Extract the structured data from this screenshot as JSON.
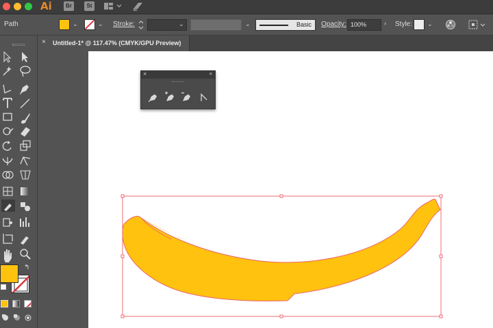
{
  "app": {
    "logo": "Ai",
    "bridge_badge": "Br",
    "stock_badge": "St"
  },
  "control_bar": {
    "selection_type": "Path",
    "fill_color": "#ffc20e",
    "stroke_label": "Stroke:",
    "brush_label": "Basic",
    "opacity_label": "Opacity:",
    "opacity_value": "100%",
    "style_label": "Style:"
  },
  "document_tab": {
    "close_glyph": "×",
    "title": "Untitled-1* @ 117.47% (CMYK/GPU Preview)"
  },
  "pen_panel": {
    "close_glyph": "×",
    "collapse_glyph": "«",
    "tools": [
      "pen-tool-icon",
      "add-anchor-point-tool-icon",
      "delete-anchor-point-tool-icon",
      "anchor-point-tool-icon"
    ]
  },
  "toolbox": {
    "fill_color": "#ffc20e",
    "stroke_color": "#d9363e",
    "tools": [
      "selection",
      "direct-selection",
      "magic-wand",
      "lasso",
      "pen",
      "curvature",
      "type",
      "line-segment",
      "rectangle",
      "paintbrush",
      "shaper",
      "eraser",
      "rotate",
      "scale",
      "width",
      "free-transform",
      "shape-builder",
      "perspective-grid",
      "mesh",
      "gradient",
      "eyedropper",
      "blend",
      "symbol-sprayer",
      "column-graph",
      "artboard",
      "slice",
      "hand",
      "zoom"
    ]
  },
  "colors": {
    "banana_fill": "#ffc20e",
    "selection_box": "#ef6b73",
    "accent": "#e0892e"
  }
}
